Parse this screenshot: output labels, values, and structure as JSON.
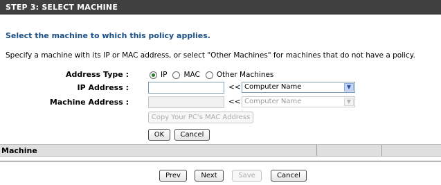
{
  "header": {
    "title": "STEP 3: SELECT MACHINE"
  },
  "subtitle": "Select the machine to which this policy applies.",
  "description": "Specify a machine with its IP or MAC address, or select \"Other Machines\" for machines that do not have a policy.",
  "form": {
    "address_type_label": "Address Type :",
    "address_type_options": [
      "IP",
      "MAC",
      "Other Machines"
    ],
    "address_type_selected": "IP",
    "ip_address_label": "IP Address :",
    "ip_address_value": "",
    "ip_chevron": "<<",
    "ip_select_value": "Computer Name",
    "machine_address_label": "Machine Address :",
    "machine_address_value": "",
    "mac_chevron": "<<",
    "mac_select_value": "Computer Name",
    "copy_mac_label": "Copy Your PC's MAC Address",
    "ok_label": "OK",
    "cancel_label": "Cancel"
  },
  "table": {
    "columns": [
      "Machine",
      "",
      ""
    ]
  },
  "footer": {
    "prev_label": "Prev",
    "next_label": "Next",
    "save_label": "Save",
    "cancel_label": "Cancel"
  }
}
